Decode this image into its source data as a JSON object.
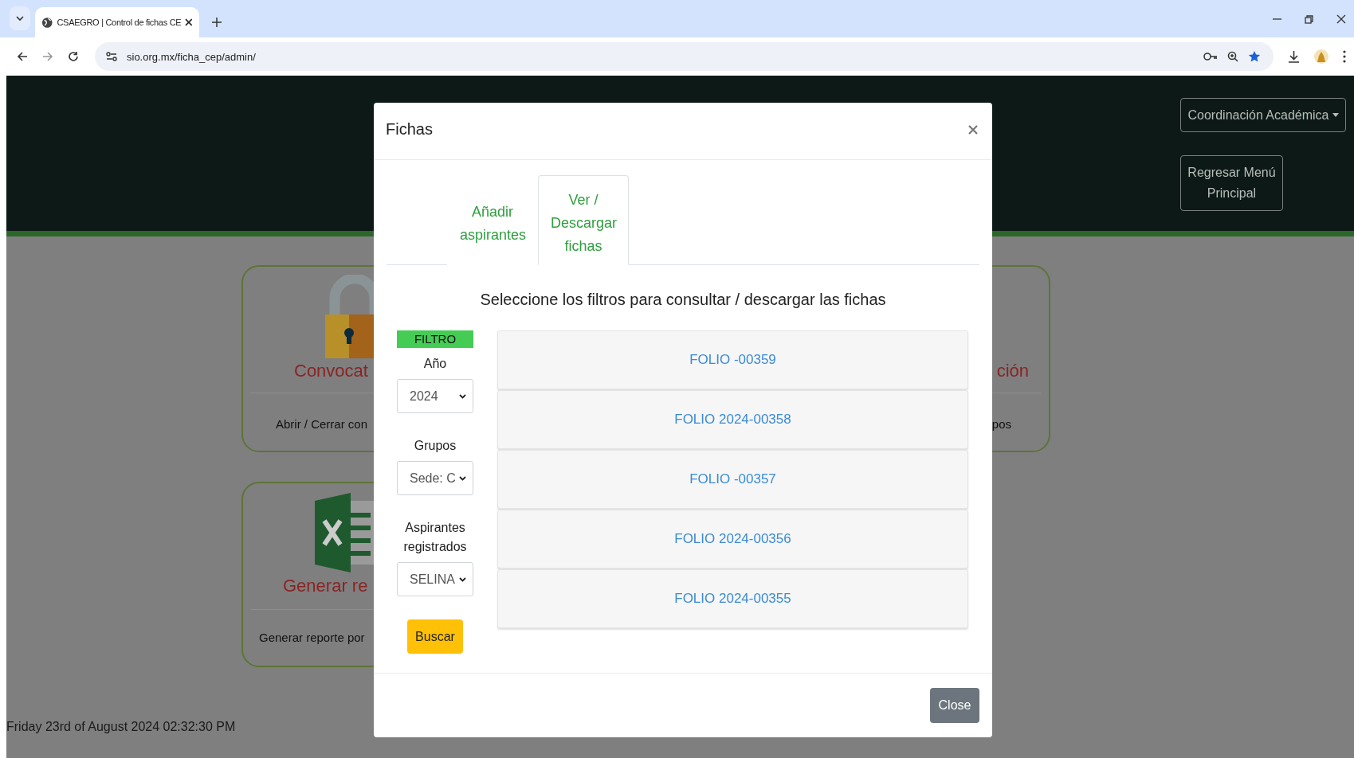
{
  "browser": {
    "tab": {
      "title": "CSAEGRO | Control de fichas CE",
      "selected": true
    },
    "url": "sio.org.mx/ficha_cep/admin/"
  },
  "header": {
    "buttons": [
      {
        "label": "Coordinación Académica",
        "kind": "dropdown"
      },
      {
        "label": "Regresar Menú Principal",
        "kind": "plain"
      }
    ]
  },
  "left_cards": [
    {
      "title": "Convocat",
      "description": "Abrir / Cerrar con",
      "kind": "lock"
    },
    {
      "title": "Generar re",
      "description": "Generar reporte por",
      "kind": "spreadsheet"
    }
  ],
  "right_card": {
    "title": "ción",
    "description": "pos"
  },
  "date": "Friday 23rd of August 2024 02:32:30 PM",
  "modal": {
    "title": "Fichas",
    "tabs": [
      {
        "label": "Añadir aspirantes",
        "selected": false
      },
      {
        "label": "Ver / Descargar fichas",
        "selected": true
      }
    ],
    "heading": "Seleccione los filtros para consultar / descargar las fichas",
    "filter": {
      "badge": "FILTRO",
      "fields": [
        {
          "label": "Año",
          "value": "2024"
        },
        {
          "label": "Grupos",
          "value": "Sede: C"
        },
        {
          "label": "Aspirantes registrados",
          "value": "SELINA"
        }
      ],
      "button": "Buscar"
    },
    "folios": [
      "FOLIO -00359",
      "FOLIO 2024-00358",
      "FOLIO -00357",
      "FOLIO 2024-00356",
      "FOLIO 2024-00355"
    ],
    "close_button": "Close"
  }
}
